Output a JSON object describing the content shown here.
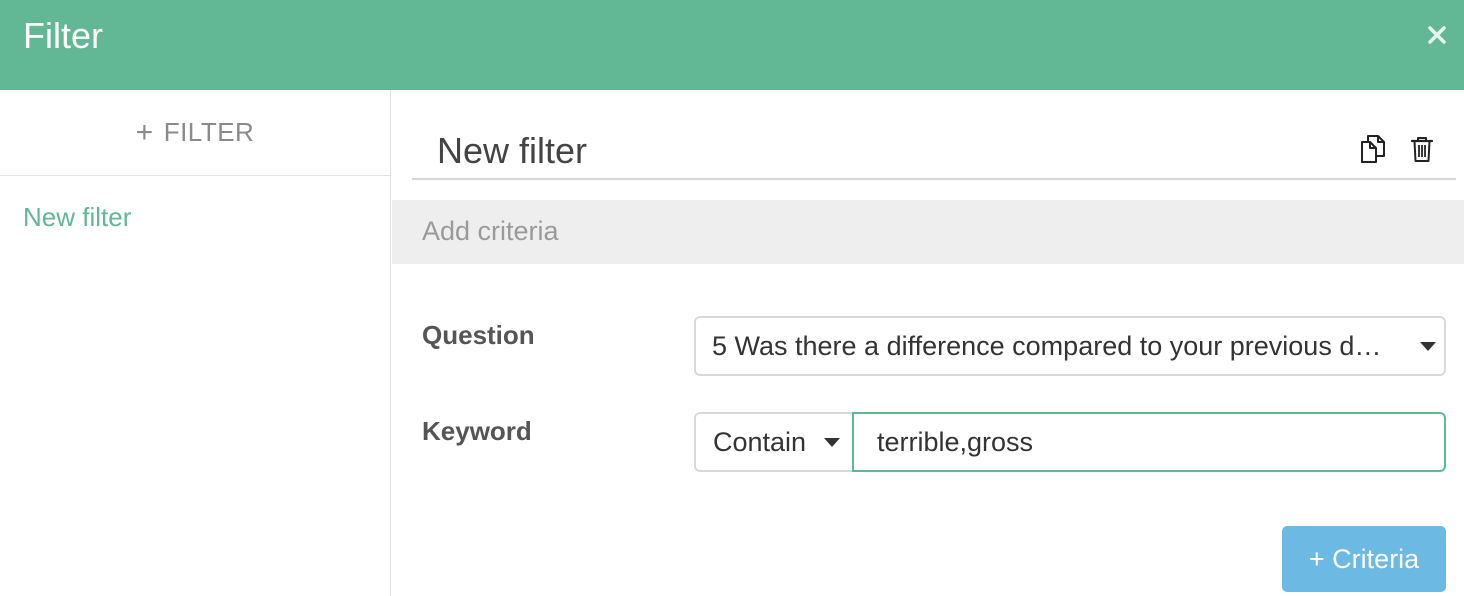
{
  "dialog": {
    "title": "Filter",
    "close_icon": "close-icon",
    "accent_color": "#62b795"
  },
  "sidebar": {
    "add_filter_label": "FILTER",
    "add_filter_icon": "plus-icon",
    "items": [
      {
        "label": "New filter",
        "selected": true
      }
    ]
  },
  "main": {
    "filter_name": "New filter",
    "copy_icon": "copy-icon",
    "delete_icon": "trash-icon",
    "criteria_header": "Add criteria",
    "question": {
      "label": "Question",
      "selected_value": "5 Was there a difference compared to your previous d…"
    },
    "keyword": {
      "label": "Keyword",
      "operator": "Contain",
      "value": "terrible,gross"
    },
    "add_criteria_label": "+ Criteria",
    "add_criteria_color": "#6cb9e4"
  }
}
